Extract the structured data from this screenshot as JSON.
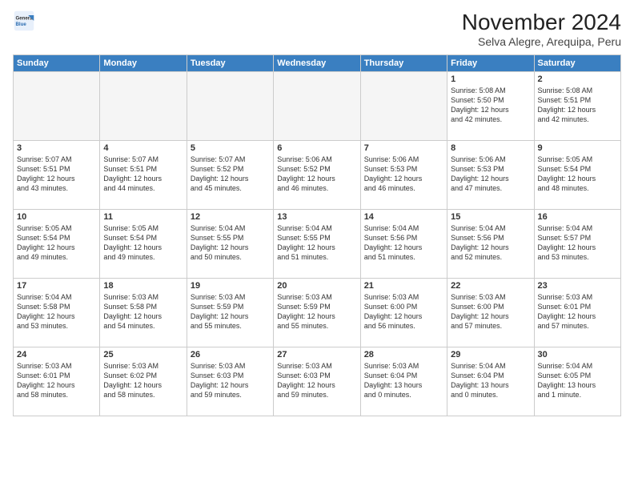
{
  "header": {
    "logo_line1": "General",
    "logo_line2": "Blue",
    "month": "November 2024",
    "location": "Selva Alegre, Arequipa, Peru"
  },
  "weekdays": [
    "Sunday",
    "Monday",
    "Tuesday",
    "Wednesday",
    "Thursday",
    "Friday",
    "Saturday"
  ],
  "weeks": [
    [
      {
        "day": "",
        "info": ""
      },
      {
        "day": "",
        "info": ""
      },
      {
        "day": "",
        "info": ""
      },
      {
        "day": "",
        "info": ""
      },
      {
        "day": "",
        "info": ""
      },
      {
        "day": "1",
        "info": "Sunrise: 5:08 AM\nSunset: 5:50 PM\nDaylight: 12 hours\nand 42 minutes."
      },
      {
        "day": "2",
        "info": "Sunrise: 5:08 AM\nSunset: 5:51 PM\nDaylight: 12 hours\nand 42 minutes."
      }
    ],
    [
      {
        "day": "3",
        "info": "Sunrise: 5:07 AM\nSunset: 5:51 PM\nDaylight: 12 hours\nand 43 minutes."
      },
      {
        "day": "4",
        "info": "Sunrise: 5:07 AM\nSunset: 5:51 PM\nDaylight: 12 hours\nand 44 minutes."
      },
      {
        "day": "5",
        "info": "Sunrise: 5:07 AM\nSunset: 5:52 PM\nDaylight: 12 hours\nand 45 minutes."
      },
      {
        "day": "6",
        "info": "Sunrise: 5:06 AM\nSunset: 5:52 PM\nDaylight: 12 hours\nand 46 minutes."
      },
      {
        "day": "7",
        "info": "Sunrise: 5:06 AM\nSunset: 5:53 PM\nDaylight: 12 hours\nand 46 minutes."
      },
      {
        "day": "8",
        "info": "Sunrise: 5:06 AM\nSunset: 5:53 PM\nDaylight: 12 hours\nand 47 minutes."
      },
      {
        "day": "9",
        "info": "Sunrise: 5:05 AM\nSunset: 5:54 PM\nDaylight: 12 hours\nand 48 minutes."
      }
    ],
    [
      {
        "day": "10",
        "info": "Sunrise: 5:05 AM\nSunset: 5:54 PM\nDaylight: 12 hours\nand 49 minutes."
      },
      {
        "day": "11",
        "info": "Sunrise: 5:05 AM\nSunset: 5:54 PM\nDaylight: 12 hours\nand 49 minutes."
      },
      {
        "day": "12",
        "info": "Sunrise: 5:04 AM\nSunset: 5:55 PM\nDaylight: 12 hours\nand 50 minutes."
      },
      {
        "day": "13",
        "info": "Sunrise: 5:04 AM\nSunset: 5:55 PM\nDaylight: 12 hours\nand 51 minutes."
      },
      {
        "day": "14",
        "info": "Sunrise: 5:04 AM\nSunset: 5:56 PM\nDaylight: 12 hours\nand 51 minutes."
      },
      {
        "day": "15",
        "info": "Sunrise: 5:04 AM\nSunset: 5:56 PM\nDaylight: 12 hours\nand 52 minutes."
      },
      {
        "day": "16",
        "info": "Sunrise: 5:04 AM\nSunset: 5:57 PM\nDaylight: 12 hours\nand 53 minutes."
      }
    ],
    [
      {
        "day": "17",
        "info": "Sunrise: 5:04 AM\nSunset: 5:58 PM\nDaylight: 12 hours\nand 53 minutes."
      },
      {
        "day": "18",
        "info": "Sunrise: 5:03 AM\nSunset: 5:58 PM\nDaylight: 12 hours\nand 54 minutes."
      },
      {
        "day": "19",
        "info": "Sunrise: 5:03 AM\nSunset: 5:59 PM\nDaylight: 12 hours\nand 55 minutes."
      },
      {
        "day": "20",
        "info": "Sunrise: 5:03 AM\nSunset: 5:59 PM\nDaylight: 12 hours\nand 55 minutes."
      },
      {
        "day": "21",
        "info": "Sunrise: 5:03 AM\nSunset: 6:00 PM\nDaylight: 12 hours\nand 56 minutes."
      },
      {
        "day": "22",
        "info": "Sunrise: 5:03 AM\nSunset: 6:00 PM\nDaylight: 12 hours\nand 57 minutes."
      },
      {
        "day": "23",
        "info": "Sunrise: 5:03 AM\nSunset: 6:01 PM\nDaylight: 12 hours\nand 57 minutes."
      }
    ],
    [
      {
        "day": "24",
        "info": "Sunrise: 5:03 AM\nSunset: 6:01 PM\nDaylight: 12 hours\nand 58 minutes."
      },
      {
        "day": "25",
        "info": "Sunrise: 5:03 AM\nSunset: 6:02 PM\nDaylight: 12 hours\nand 58 minutes."
      },
      {
        "day": "26",
        "info": "Sunrise: 5:03 AM\nSunset: 6:03 PM\nDaylight: 12 hours\nand 59 minutes."
      },
      {
        "day": "27",
        "info": "Sunrise: 5:03 AM\nSunset: 6:03 PM\nDaylight: 12 hours\nand 59 minutes."
      },
      {
        "day": "28",
        "info": "Sunrise: 5:03 AM\nSunset: 6:04 PM\nDaylight: 13 hours\nand 0 minutes."
      },
      {
        "day": "29",
        "info": "Sunrise: 5:04 AM\nSunset: 6:04 PM\nDaylight: 13 hours\nand 0 minutes."
      },
      {
        "day": "30",
        "info": "Sunrise: 5:04 AM\nSunset: 6:05 PM\nDaylight: 13 hours\nand 1 minute."
      }
    ]
  ]
}
